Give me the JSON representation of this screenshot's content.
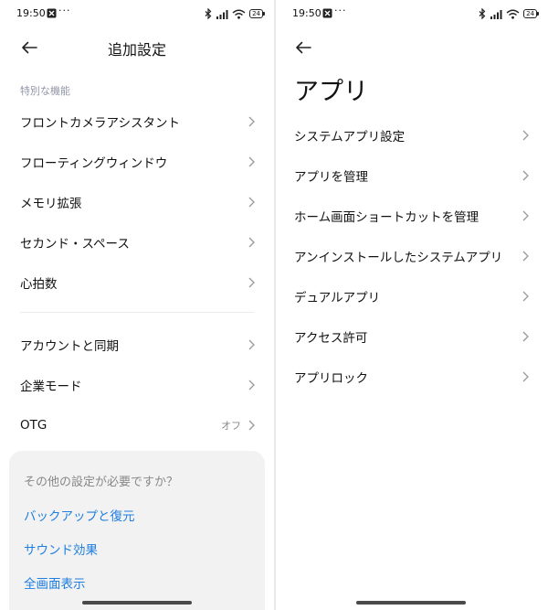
{
  "status_bar": {
    "time": "19:50",
    "dots": "···",
    "battery": "24"
  },
  "left": {
    "title": "追加設定",
    "section_label": "特別な機能",
    "group1": [
      {
        "label": "フロントカメラアシスタント"
      },
      {
        "label": "フローティングウィンドウ"
      },
      {
        "label": "メモリ拡張"
      },
      {
        "label": "セカンド・スペース"
      },
      {
        "label": "心拍数"
      }
    ],
    "group2": [
      {
        "label": "アカウントと同期",
        "value": ""
      },
      {
        "label": "企業モード",
        "value": ""
      },
      {
        "label": "OTG",
        "value": "オフ"
      }
    ],
    "more": {
      "title": "その他の設定が必要ですか？",
      "links": [
        "バックアップと復元",
        "サウンド効果",
        "全画面表示"
      ]
    }
  },
  "right": {
    "title": "アプリ",
    "items": [
      {
        "label": "システムアプリ設定"
      },
      {
        "label": "アプリを管理"
      },
      {
        "label": "ホーム画面ショートカットを管理"
      },
      {
        "label": "アンインストールしたシステムアプリ"
      },
      {
        "label": "デュアルアプリ"
      },
      {
        "label": "アクセス許可"
      },
      {
        "label": "アプリロック"
      }
    ]
  },
  "colors": {
    "link": "#1f7ee0",
    "section_label": "#9096a8",
    "card_bg": "#f2f2f2"
  },
  "icons": {
    "back": "back-arrow-icon",
    "chevron": "chevron-right-icon",
    "bluetooth": "bluetooth-icon",
    "signal": "signal-icon",
    "wifi": "wifi-icon",
    "battery": "battery-icon",
    "notification": "app-notification-icon"
  }
}
